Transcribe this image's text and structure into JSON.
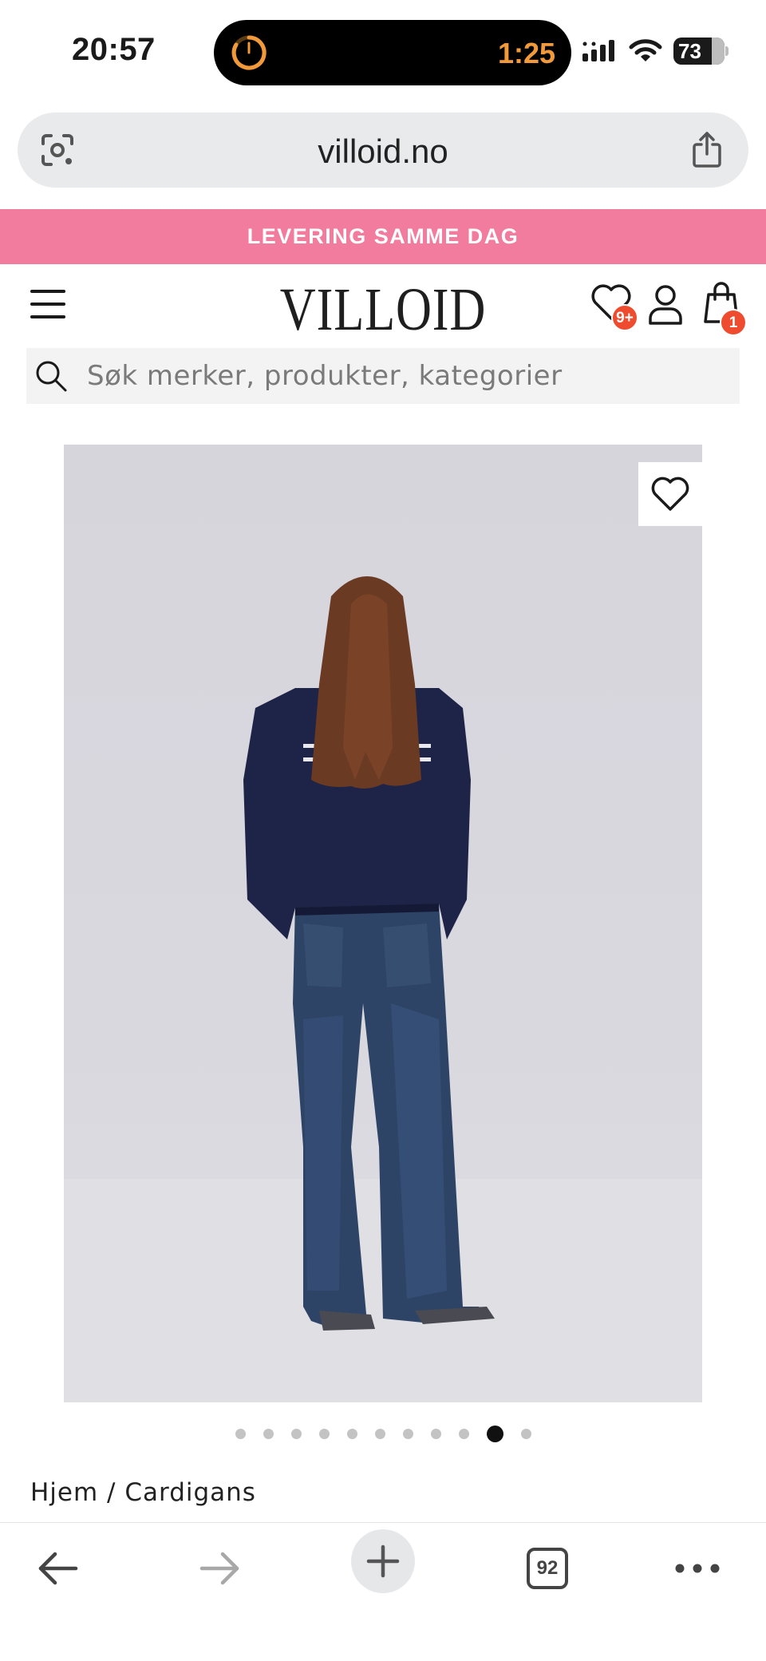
{
  "status_bar": {
    "time": "20:57",
    "timer": "1:25",
    "battery": "73"
  },
  "browser": {
    "url": "villoid.no",
    "tabs_count": "92"
  },
  "promo_banner": {
    "text": "LEVERING SAMME DAG"
  },
  "header": {
    "logo": "VILLOID",
    "wishlist_badge": "9+",
    "cart_badge": "1"
  },
  "search": {
    "placeholder": "Søk merker, produkter, kategorier"
  },
  "gallery": {
    "total_images": 11,
    "active_index": 9
  },
  "breadcrumb": {
    "text": "Hjem / Cardigans"
  },
  "colors": {
    "promo_bg": "#f27c9e",
    "badge": "#ef4b2e",
    "timer": "#f29a3a"
  }
}
